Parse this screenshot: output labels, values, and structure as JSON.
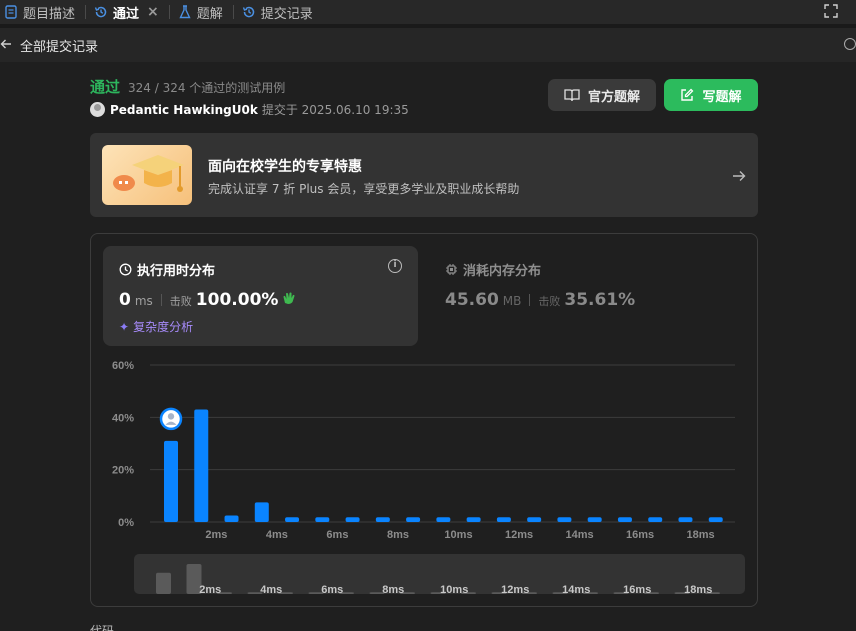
{
  "tabs": [
    {
      "label": "题目描述",
      "icon": "document-icon",
      "active": false
    },
    {
      "label": "通过",
      "icon": "history-icon",
      "active": true
    },
    {
      "label": "题解",
      "icon": "flask-icon",
      "active": false
    },
    {
      "label": "提交记录",
      "icon": "history-icon",
      "active": false
    }
  ],
  "tab_close": "×",
  "back": {
    "label": "全部提交记录"
  },
  "submission": {
    "status": "通过",
    "tests": "324 / 324 个通过的测试用例",
    "username": "Pedantic HawkingU0k",
    "submitted": "提交于 2025.06.10 19:35"
  },
  "buttons": {
    "official": "官方题解",
    "write": "写题解"
  },
  "promo": {
    "title": "面向在校学生的专享特惠",
    "subtitle": "完成认证享 7 折 Plus 会员，享受更多学业及职业成长帮助"
  },
  "runtime": {
    "title": "执行用时分布",
    "value": "0",
    "unit": "ms",
    "beat_label": "击败",
    "beat": "100.00%",
    "complexity": "复杂度分析"
  },
  "memory": {
    "title": "消耗内存分布",
    "value": "45.60",
    "unit": "MB",
    "beat_label": "击败",
    "beat": "35.61%"
  },
  "chart_data": {
    "type": "bar",
    "ylabel": "",
    "yticks": [
      "0%",
      "20%",
      "40%",
      "60%"
    ],
    "ylim": [
      0,
      60
    ],
    "xticks": [
      "2ms",
      "4ms",
      "6ms",
      "8ms",
      "10ms",
      "12ms",
      "14ms",
      "16ms",
      "18ms"
    ],
    "values": [
      31,
      43,
      2.5,
      7.5,
      1.8,
      1.8,
      1.8,
      1.8,
      1.8,
      1.8,
      1.8,
      1.8,
      1.8,
      1.8,
      1.8,
      1.8,
      1.8,
      1.8,
      1.8
    ],
    "highlight_index": 0,
    "bar_color": "#0a84ff",
    "grid": true
  },
  "mini_chart": {
    "values": [
      24,
      34,
      2,
      2,
      2,
      2,
      2,
      2,
      2,
      2,
      2,
      2,
      2,
      2,
      2,
      2,
      2,
      2,
      2
    ],
    "xticks": [
      "2ms",
      "4ms",
      "6ms",
      "8ms",
      "10ms",
      "12ms",
      "14ms",
      "16ms",
      "18ms"
    ],
    "color": "#5a5a5a"
  },
  "code_label": "代码"
}
